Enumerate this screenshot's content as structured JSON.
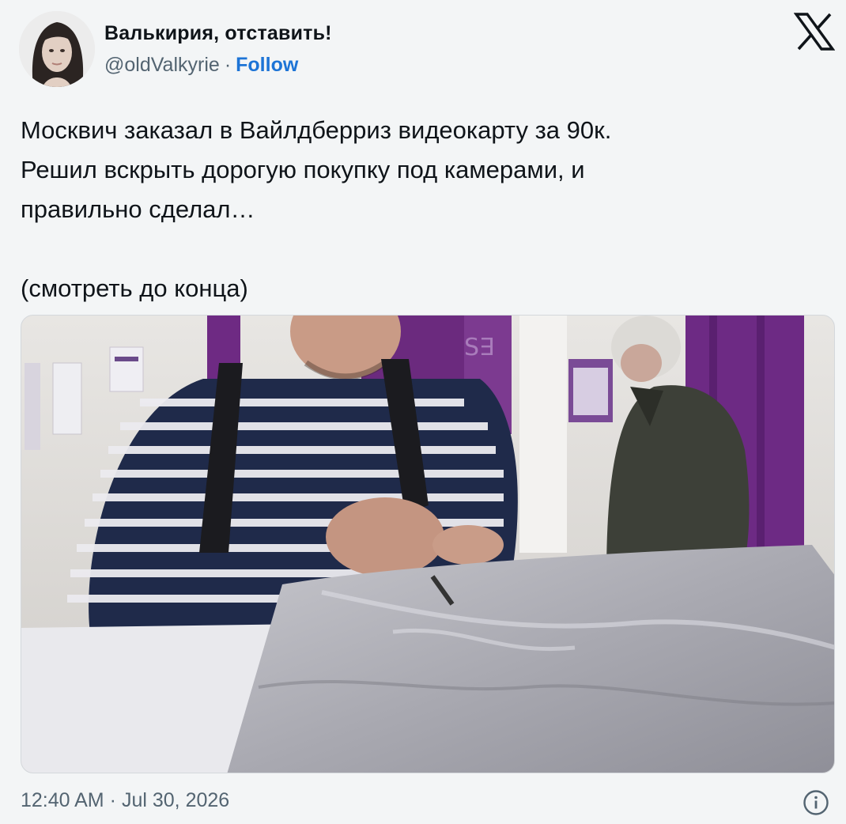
{
  "author": {
    "display_name": "Валькирия, отставить!",
    "handle": "@oldValkyrie",
    "separator": "·",
    "follow_label": "Follow",
    "avatar_icon": "avatar-photo"
  },
  "platform": {
    "logo_icon": "x-logo-icon"
  },
  "tweet": {
    "lines": [
      "Москвич заказал в Вайлдберриз видеокарту за 90к.",
      "Решил вскрыть дорогую покупку под камерами, и",
      "правильно сделал…"
    ],
    "footer_line": "(смотреть до конца)"
  },
  "media": {
    "type": "video-frame",
    "icon": "video-thumbnail"
  },
  "meta": {
    "time": "12:40 AM",
    "separator": "·",
    "date": "Jul 30, 2026",
    "info_icon": "info-icon"
  },
  "colors": {
    "link": "#1d74d6",
    "secondary_text": "#536471",
    "primary_text": "#0f1419",
    "background": "#f3f5f6"
  }
}
